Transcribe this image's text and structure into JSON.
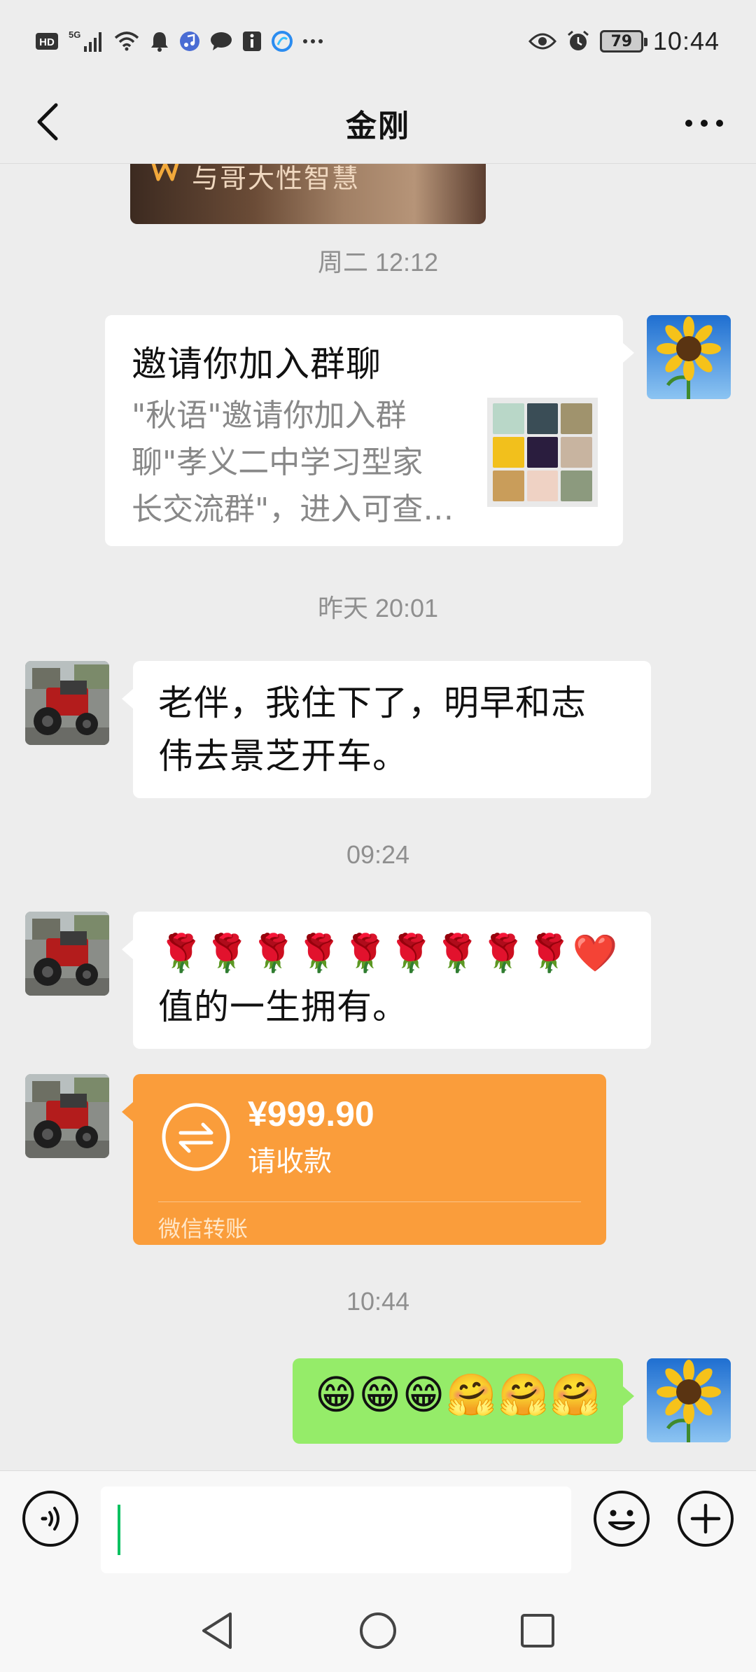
{
  "status_bar": {
    "network_label": "HD",
    "signal_label": "5G",
    "battery_level": "79",
    "time": "10:44",
    "icons": [
      "hd-icon",
      "5g-signal-icon",
      "wifi-icon",
      "bell-icon",
      "music-icon",
      "chat-bubble-icon",
      "info-icon",
      "browser-icon",
      "more-dots-icon",
      "eye-icon",
      "alarm-icon",
      "battery-icon"
    ]
  },
  "header": {
    "title": "金刚",
    "back_icon": "chevron-left-icon",
    "more_icon": "more-dots-icon"
  },
  "chat": {
    "clipped_card_text": "与哥大性智慧",
    "timestamps": [
      "周二 12:12",
      "昨天 20:01",
      "09:24",
      "10:44"
    ],
    "invite": {
      "title": "邀请你加入群聊",
      "desc_lines": [
        "\"秋语\"邀请你加入群",
        "聊\"孝义二中学习型家",
        "长交流群\"，进入可查…"
      ]
    },
    "msg_text_1": "老伴，我住下了，明早和志伟去景芝开车。",
    "msg_text_1_lines": [
      "老伴，我住下了，明早和志",
      "伟去景芝开车。"
    ],
    "msg_roses": "🌹🌹🌹🌹🌹🌹🌹🌹🌹❤️",
    "msg_roses_line2": "值的一生拥有。",
    "transfer": {
      "amount": "¥999.90",
      "status": "请收款",
      "footer": "微信转账"
    },
    "msg_emojis": "😁😁😁🤗🤗🤗"
  },
  "input_bar": {
    "voice_icon": "voice-icon",
    "emoji_icon": "smiley-icon",
    "plus_icon": "plus-circle-icon",
    "value": ""
  },
  "system_nav": {
    "icons": [
      "back-triangle-icon",
      "home-circle-icon",
      "recents-square-icon"
    ]
  },
  "colors": {
    "background": "#ededed",
    "bubble_self": "#95ec69",
    "bubble_other": "#ffffff",
    "transfer": "#fa9d3b",
    "accent": "#07c160"
  }
}
